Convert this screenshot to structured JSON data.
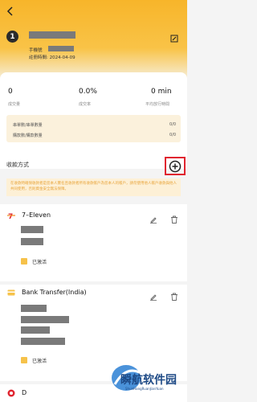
{
  "header": {
    "back_icon": "chevron-left-icon",
    "badge_number": "1",
    "phone_label": "手機號",
    "register_label": "註冊時間: 2024-04-09",
    "edit_icon": "edit-icon"
  },
  "stats": [
    {
      "value": "0",
      "label": "成交量"
    },
    {
      "value": "0.0%",
      "label": "成交率"
    },
    {
      "value": "0 min",
      "label": "平均放行時間"
    }
  ],
  "limits": [
    {
      "label": "串單數/串單數量",
      "value": "0/0"
    },
    {
      "label": "購款數/購款數量",
      "value": "0/0"
    }
  ],
  "payment": {
    "section_title": "收款方式",
    "add_icon": "plus-circle-icon",
    "notice": "在收款時確保收款者是您本人實名且收款者所有收款帳戶為您本人的帳戶，請勿使用他人帳戶收款與他人共同使用，否則資金安全無法保障。"
  },
  "methods": [
    {
      "name": "7–Eleven",
      "status": "已激活",
      "icon": "seven-eleven-icon"
    },
    {
      "name": "Bank Transfer(India)",
      "status": "已激活",
      "icon": "bank-card-icon"
    },
    {
      "name": "D",
      "icon": "round-logo-icon"
    }
  ],
  "watermark": {
    "title": "瞬航软件园",
    "subtitle": "ShunHangRuanJianYuan"
  },
  "colors": {
    "accent": "#f7b52a",
    "highlight": "#e0242f"
  }
}
